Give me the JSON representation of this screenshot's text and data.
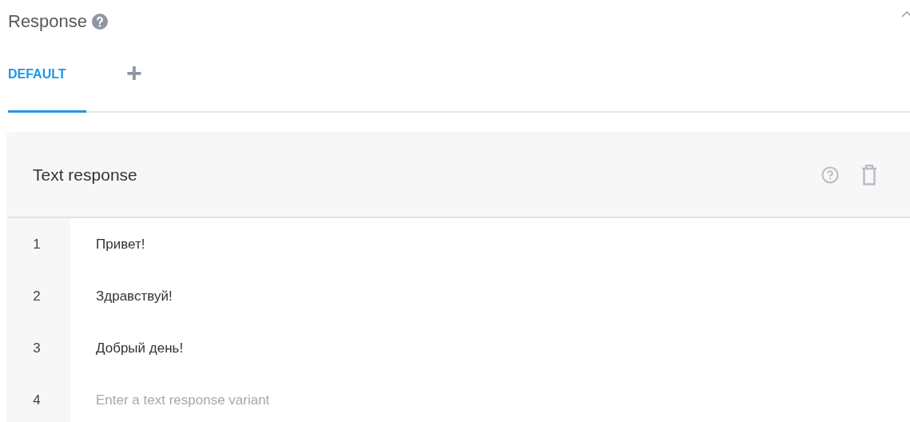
{
  "section": {
    "title": "Response",
    "collapsed": false
  },
  "tabs": [
    {
      "label": "DEFAULT",
      "selected": true,
      "kind": "text"
    },
    {
      "label": "+",
      "selected": false,
      "kind": "add"
    }
  ],
  "card": {
    "title": "Text response",
    "rows": [
      {
        "number": "1",
        "kind": "text",
        "text": "Привет!"
      },
      {
        "number": "2",
        "kind": "text",
        "text": "Здравствуй!"
      },
      {
        "number": "3",
        "kind": "text",
        "text": "Добрый день!"
      },
      {
        "number": "4",
        "kind": "input",
        "placeholder": "Enter a text response variant"
      }
    ]
  }
}
